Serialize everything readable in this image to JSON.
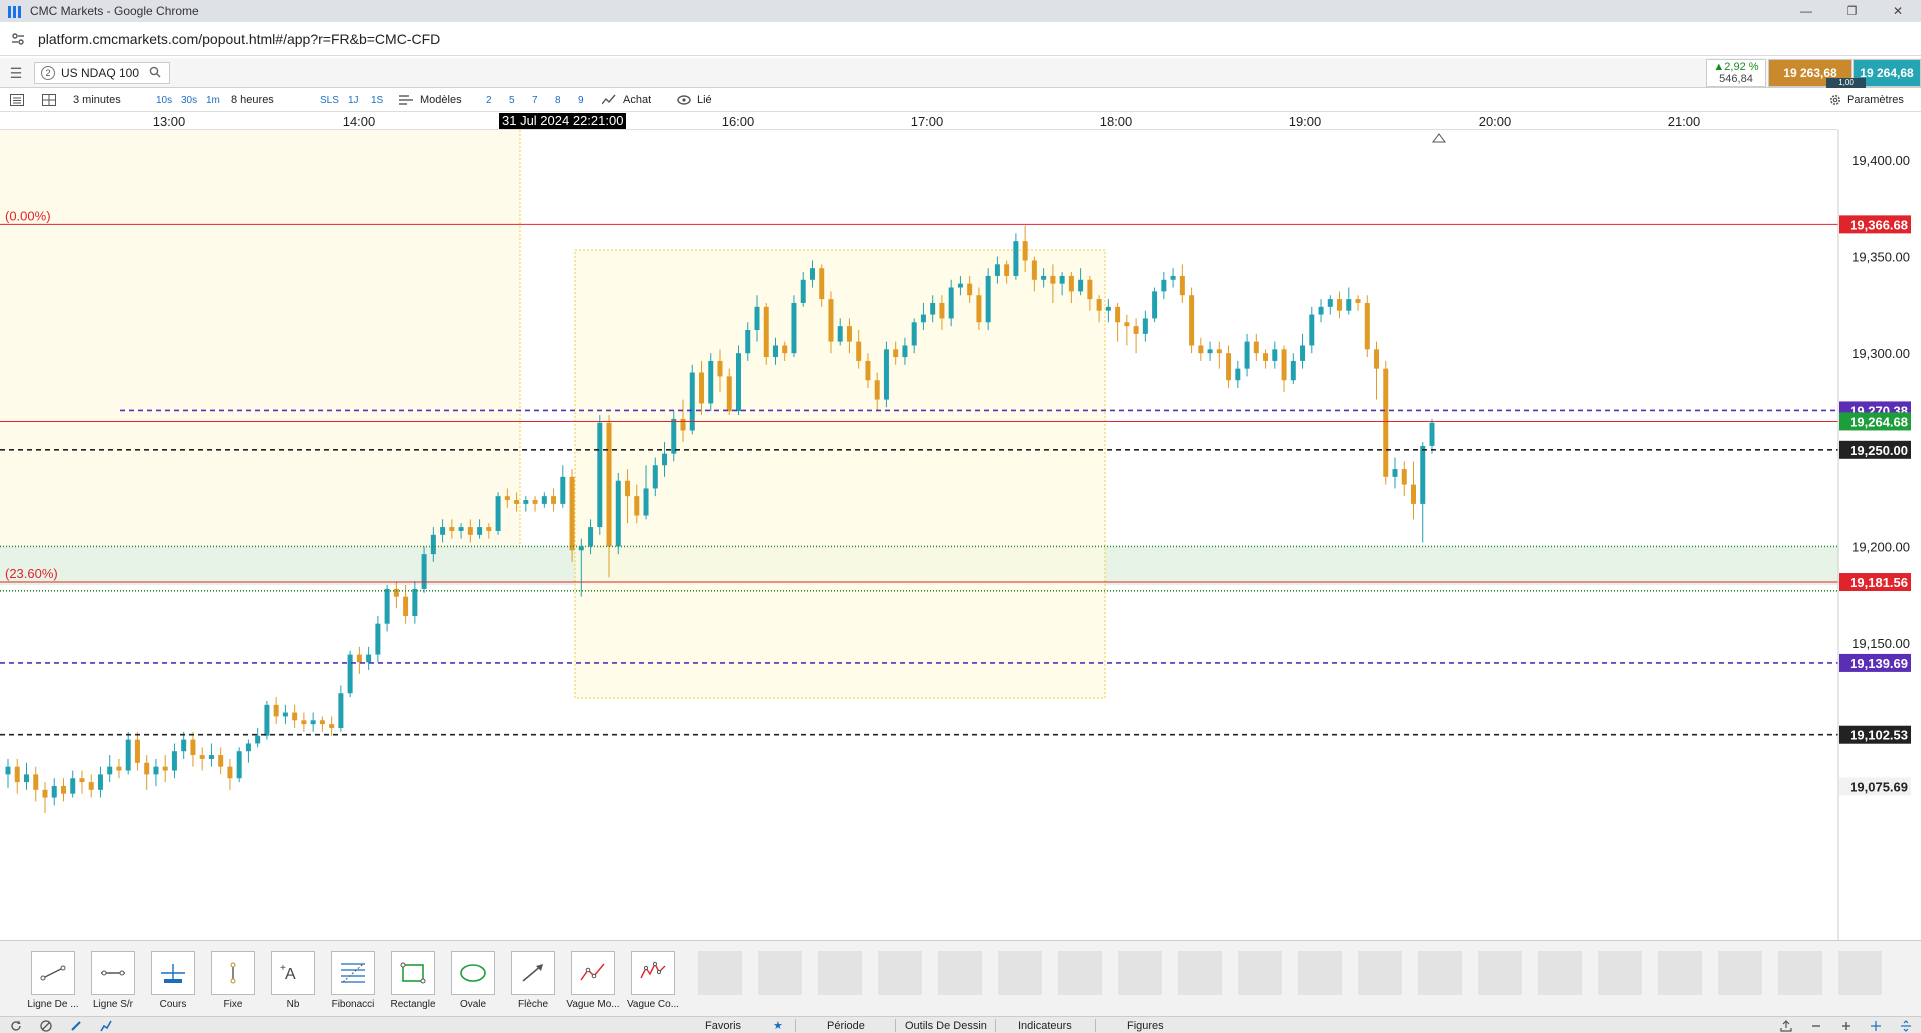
{
  "window": {
    "title": "CMC Markets - Google Chrome",
    "url": "platform.cmcmarkets.com/popout.html#/app?r=FR&b=CMC-CFD",
    "controls": [
      "—",
      "❐",
      "✕"
    ]
  },
  "header": {
    "tab_number": "2",
    "instrument": "US NDAQ 100",
    "change_pct": "▲2,92 %",
    "change_pts": "546,84",
    "sell_price": "19 263,68",
    "buy_price": "19 264,68",
    "spread": "1,00"
  },
  "toolbar": {
    "interval": "3 minutes",
    "quick_intervals": [
      "10s",
      "30s",
      "1m"
    ],
    "range": "8 heures",
    "quick_ranges": [
      "SLS",
      "1J",
      "1S"
    ],
    "templates_label": "Modèles",
    "template_slots": [
      "2",
      "5",
      "7",
      "8",
      "9"
    ],
    "buy_label": "Achat",
    "link_label": "Lié",
    "settings_label": "Paramètres"
  },
  "xaxis": {
    "ticks": [
      "13:00",
      "14:00",
      "16:00",
      "17:00",
      "18:00",
      "19:00",
      "20:00",
      "21:00"
    ],
    "cursor_time": "31 Jul 2024 22:21:00"
  },
  "chart_data": {
    "type": "candlestick",
    "instrument": "US NDAQ 100",
    "interval": "3 minutes",
    "ylim": [
      19060,
      19400
    ],
    "y_ticks": [
      "19,400.00",
      "19,350.00",
      "19,300.00",
      "19,200.00",
      "19,150.00"
    ],
    "price_labels": [
      {
        "text": "19,366.68",
        "color": "#e0242b"
      },
      {
        "text": "19,270.38",
        "color": "#5a2fb5"
      },
      {
        "text": "19,264.68",
        "color": "#1e9e3a"
      },
      {
        "text": "19,250.00",
        "color": "#222222"
      },
      {
        "text": "19,181.56",
        "color": "#e0242b"
      },
      {
        "text": "19,139.69",
        "color": "#5a2fb5"
      },
      {
        "text": "19,102.53",
        "color": "#222222"
      },
      {
        "text": "19,075.69",
        "color": "#f2f2f2"
      }
    ],
    "fib_labels": [
      "(0.00%)",
      "(23.60%)"
    ],
    "bull_color": "#21a1b0",
    "bear_color": "#e09a25",
    "candles": [
      [
        19082,
        19086,
        19075,
        19090
      ],
      [
        19086,
        19078,
        19072,
        19090
      ],
      [
        19078,
        19082,
        19074,
        19088
      ],
      [
        19082,
        19074,
        19068,
        19086
      ],
      [
        19074,
        19070,
        19062,
        19078
      ],
      [
        19070,
        19076,
        19066,
        19080
      ],
      [
        19076,
        19072,
        19068,
        19080
      ],
      [
        19072,
        19080,
        19070,
        19084
      ],
      [
        19080,
        19078,
        19072,
        19084
      ],
      [
        19078,
        19074,
        19070,
        19082
      ],
      [
        19074,
        19082,
        19070,
        19086
      ],
      [
        19082,
        19086,
        19078,
        19092
      ],
      [
        19086,
        19084,
        19080,
        19090
      ],
      [
        19084,
        19100,
        19082,
        19104
      ],
      [
        19100,
        19088,
        19084,
        19104
      ],
      [
        19088,
        19082,
        19074,
        19092
      ],
      [
        19082,
        19086,
        19076,
        19090
      ],
      [
        19086,
        19084,
        19078,
        19092
      ],
      [
        19084,
        19094,
        19080,
        19098
      ],
      [
        19094,
        19100,
        19090,
        19104
      ],
      [
        19100,
        19092,
        19086,
        19104
      ],
      [
        19092,
        19090,
        19084,
        19096
      ],
      [
        19090,
        19092,
        19086,
        19098
      ],
      [
        19092,
        19086,
        19082,
        19096
      ],
      [
        19086,
        19080,
        19074,
        19090
      ],
      [
        19080,
        19094,
        19078,
        19096
      ],
      [
        19094,
        19098,
        19088,
        19100
      ],
      [
        19098,
        19102,
        19096,
        19106
      ],
      [
        19102,
        19118,
        19100,
        19120
      ],
      [
        19118,
        19112,
        19108,
        19122
      ],
      [
        19112,
        19114,
        19108,
        19118
      ],
      [
        19114,
        19110,
        19106,
        19118
      ],
      [
        19110,
        19108,
        19104,
        19114
      ],
      [
        19108,
        19110,
        19104,
        19114
      ],
      [
        19110,
        19108,
        19104,
        19112
      ],
      [
        19108,
        19106,
        19102,
        19112
      ],
      [
        19106,
        19124,
        19104,
        19128
      ],
      [
        19124,
        19144,
        19122,
        19146
      ],
      [
        19144,
        19140,
        19134,
        19148
      ],
      [
        19140,
        19144,
        19136,
        19148
      ],
      [
        19144,
        19160,
        19140,
        19164
      ],
      [
        19160,
        19178,
        19156,
        19180
      ],
      [
        19178,
        19174,
        19168,
        19182
      ],
      [
        19174,
        19164,
        19160,
        19180
      ],
      [
        19164,
        19178,
        19160,
        19182
      ],
      [
        19178,
        19196,
        19176,
        19200
      ],
      [
        19196,
        19206,
        19192,
        19210
      ],
      [
        19206,
        19210,
        19202,
        19214
      ],
      [
        19210,
        19208,
        19204,
        19214
      ],
      [
        19208,
        19210,
        19204,
        19212
      ],
      [
        19210,
        19206,
        19202,
        19214
      ],
      [
        19206,
        19210,
        19204,
        19214
      ],
      [
        19210,
        19208,
        19204,
        19212
      ],
      [
        19208,
        19226,
        19206,
        19228
      ],
      [
        19226,
        19224,
        19220,
        19230
      ],
      [
        19224,
        19222,
        19218,
        19228
      ],
      [
        19222,
        19224,
        19218,
        19226
      ],
      [
        19224,
        19222,
        19218,
        19226
      ],
      [
        19222,
        19226,
        19220,
        19228
      ],
      [
        19226,
        19222,
        19218,
        19230
      ],
      [
        19222,
        19236,
        19220,
        19242
      ],
      [
        19236,
        19198,
        19192,
        19240
      ],
      [
        19198,
        19200,
        19174,
        19204
      ],
      [
        19200,
        19210,
        19196,
        19214
      ],
      [
        19210,
        19264,
        19206,
        19268
      ],
      [
        19264,
        19200,
        19184,
        19268
      ],
      [
        19200,
        19234,
        19196,
        19238
      ],
      [
        19234,
        19226,
        19212,
        19240
      ],
      [
        19226,
        19216,
        19212,
        19232
      ],
      [
        19216,
        19230,
        19214,
        19242
      ],
      [
        19230,
        19242,
        19226,
        19246
      ],
      [
        19242,
        19248,
        19236,
        19254
      ],
      [
        19248,
        19266,
        19244,
        19270
      ],
      [
        19266,
        19260,
        19254,
        19276
      ],
      [
        19260,
        19290,
        19258,
        19294
      ],
      [
        19290,
        19274,
        19268,
        19296
      ],
      [
        19274,
        19296,
        19270,
        19300
      ],
      [
        19296,
        19288,
        19280,
        19302
      ],
      [
        19288,
        19270,
        19268,
        19292
      ],
      [
        19270,
        19300,
        19268,
        19304
      ],
      [
        19300,
        19312,
        19296,
        19316
      ],
      [
        19312,
        19324,
        19306,
        19330
      ],
      [
        19324,
        19298,
        19294,
        19326
      ],
      [
        19298,
        19304,
        19294,
        19308
      ],
      [
        19304,
        19300,
        19296,
        19306
      ],
      [
        19300,
        19326,
        19298,
        19330
      ],
      [
        19326,
        19338,
        19324,
        19342
      ],
      [
        19338,
        19344,
        19334,
        19348
      ],
      [
        19344,
        19328,
        19324,
        19346
      ],
      [
        19328,
        19306,
        19300,
        19332
      ],
      [
        19306,
        19314,
        19304,
        19318
      ],
      [
        19314,
        19306,
        19300,
        19318
      ],
      [
        19306,
        19296,
        19292,
        19312
      ],
      [
        19296,
        19286,
        19282,
        19300
      ],
      [
        19286,
        19276,
        19270,
        19290
      ],
      [
        19276,
        19302,
        19272,
        19306
      ],
      [
        19302,
        19298,
        19294,
        19306
      ],
      [
        19298,
        19304,
        19294,
        19308
      ],
      [
        19304,
        19316,
        19300,
        19318
      ],
      [
        19316,
        19320,
        19312,
        19326
      ],
      [
        19320,
        19326,
        19316,
        19330
      ],
      [
        19326,
        19318,
        19312,
        19330
      ],
      [
        19318,
        19334,
        19314,
        19338
      ],
      [
        19334,
        19336,
        19330,
        19340
      ],
      [
        19336,
        19330,
        19326,
        19340
      ],
      [
        19330,
        19316,
        19312,
        19334
      ],
      [
        19316,
        19340,
        19312,
        19344
      ],
      [
        19340,
        19346,
        19336,
        19350
      ],
      [
        19346,
        19340,
        19336,
        19348
      ],
      [
        19340,
        19358,
        19338,
        19362
      ],
      [
        19358,
        19348,
        19342,
        19366
      ],
      [
        19348,
        19338,
        19332,
        19350
      ],
      [
        19338,
        19340,
        19334,
        19344
      ],
      [
        19340,
        19336,
        19326,
        19346
      ],
      [
        19336,
        19340,
        19330,
        19342
      ],
      [
        19340,
        19332,
        19326,
        19342
      ],
      [
        19332,
        19338,
        19330,
        19344
      ],
      [
        19338,
        19328,
        19322,
        19340
      ],
      [
        19328,
        19322,
        19316,
        19330
      ],
      [
        19322,
        19324,
        19316,
        19328
      ],
      [
        19324,
        19316,
        19306,
        19326
      ],
      [
        19316,
        19314,
        19304,
        19320
      ],
      [
        19314,
        19310,
        19300,
        19318
      ],
      [
        19310,
        19318,
        19306,
        19322
      ],
      [
        19318,
        19332,
        19316,
        19334
      ],
      [
        19332,
        19338,
        19328,
        19342
      ],
      [
        19338,
        19340,
        19334,
        19344
      ],
      [
        19340,
        19330,
        19326,
        19346
      ],
      [
        19330,
        19304,
        19300,
        19334
      ],
      [
        19304,
        19300,
        19296,
        19308
      ],
      [
        19300,
        19302,
        19296,
        19306
      ],
      [
        19302,
        19300,
        19292,
        19306
      ],
      [
        19300,
        19286,
        19282,
        19304
      ],
      [
        19286,
        19292,
        19282,
        19296
      ],
      [
        19292,
        19306,
        19288,
        19310
      ],
      [
        19306,
        19300,
        19296,
        19310
      ],
      [
        19300,
        19296,
        19292,
        19302
      ],
      [
        19296,
        19302,
        19292,
        19306
      ],
      [
        19302,
        19286,
        19280,
        19304
      ],
      [
        19286,
        19296,
        19284,
        19300
      ],
      [
        19296,
        19304,
        19292,
        19310
      ],
      [
        19304,
        19320,
        19300,
        19324
      ],
      [
        19320,
        19324,
        19316,
        19328
      ],
      [
        19324,
        19328,
        19320,
        19330
      ],
      [
        19328,
        19322,
        19318,
        19332
      ],
      [
        19322,
        19328,
        19320,
        19334
      ],
      [
        19328,
        19326,
        19322,
        19330
      ],
      [
        19326,
        19302,
        19298,
        19330
      ],
      [
        19302,
        19292,
        19276,
        19306
      ],
      [
        19292,
        19236,
        19232,
        19296
      ],
      [
        19236,
        19240,
        19230,
        19246
      ],
      [
        19240,
        19232,
        19226,
        19244
      ],
      [
        19232,
        19222,
        19214,
        19244
      ],
      [
        19222,
        19252,
        19202,
        19254
      ],
      [
        19252,
        19264,
        19248,
        19266
      ]
    ]
  },
  "drawing_tools": [
    {
      "label": "Ligne De ..."
    },
    {
      "label": "Ligne S/r"
    },
    {
      "label": "Cours"
    },
    {
      "label": "Fixe"
    },
    {
      "label": "Nb"
    },
    {
      "label": "Fibonacci"
    },
    {
      "label": "Rectangle"
    },
    {
      "label": "Ovale"
    },
    {
      "label": "Flèche"
    },
    {
      "label": "Vague Mo..."
    },
    {
      "label": "Vague Co..."
    }
  ],
  "bottom_tabs": {
    "favorites": "Favoris",
    "period": "Période",
    "drawing_tools": "Outils De Dessin",
    "indicators": "Indicateurs",
    "figures": "Figures"
  }
}
